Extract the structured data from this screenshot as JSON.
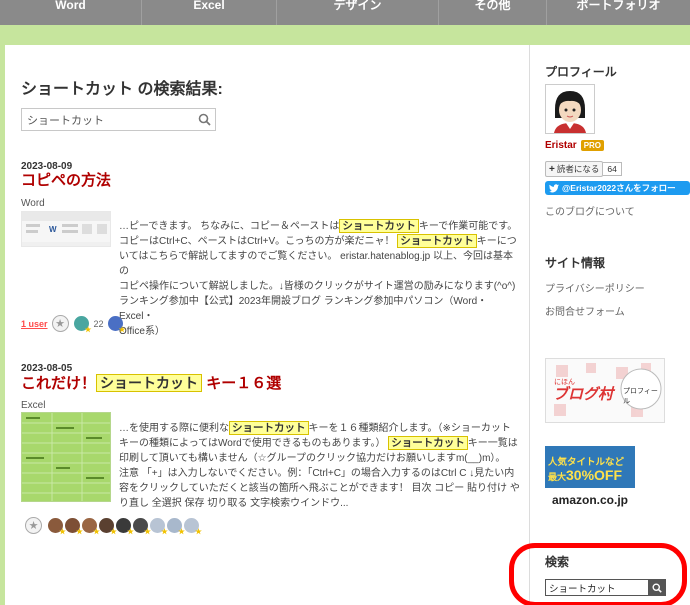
{
  "nav": [
    "Word",
    "Excel",
    "デザイン",
    "その他",
    "ポートフォリオ"
  ],
  "page_title": "ショートカット の検索結果:",
  "search_query": "ショートカット",
  "entries": [
    {
      "date": "2023-08-09",
      "title": "コピペの方法",
      "category": "Word",
      "excerpt": {
        "l1a": "…ピーできます。 ちなみに、コピー＆ペーストは",
        "hl": "ショートカット",
        "l1b": "キーで作業可能です。",
        "l2": "コピーはCtrl+C、ペーストはCtrl+V。こっちの方が楽だニャ！",
        "l2b": "キーにつ",
        "l3": "いてはこちらで解説してますのでご覧ください。 eristar.hatenablog.jp 以上、今回は基本の",
        "l4": "コピペ操作について解説しました。↓皆様のクリックがサイト運営の励みになります(^o^)",
        "l5": "ランキング参加中【公式】2023年開設ブログ ランキング参加中パソコン（Word・Excel・",
        "l6": "Office系）"
      },
      "users_label": "1 user",
      "star_count": "22"
    },
    {
      "date": "2023-08-05",
      "title_pre": "これだけ！",
      "title_hl": "ショートカット",
      "title_post": "キー１６選",
      "category": "Excel",
      "excerpt": {
        "l1a": "…を使用する際に便利な",
        "hl": "ショートカット",
        "l1b": "キーを１６種類紹介します。（※ショーカット",
        "l2": "キーの種類によってはWordで使用できるものもあります。）",
        "l2b": "キー一覧は",
        "l3": "印刷して頂いても構いません（☆グループのクリック協力だけお願いしますm(__)m）。",
        "l4": "注意 「+」は入力しないでください。例：「Ctrl+C」の場合入力するのはCtrl C ↓見たい内",
        "l5": "容をクリックしていただくと該当の箇所へ飛ぶことができます！ 目次 コピー 貼り付け や",
        "l6": "り直し 全選択 保存 切り取る 文字検索ウインドウ..."
      }
    }
  ],
  "sidebar": {
    "profile_heading": "プロフィール",
    "name": "Eristar",
    "pro_badge": "PRO",
    "reader_button": "読者になる",
    "reader_count": "64",
    "twitter_follow": "@Eristar2022さんをフォロー",
    "about_link": "このブログについて",
    "site_info_heading": "サイト情報",
    "privacy_link": "プライバシーポリシー",
    "contact_link": "お問合せフォーム",
    "blogmura_text": "ブログ村",
    "blogmura_sub": "にほん",
    "blogmura_profile": "プロフィール",
    "amazon_line1": "人気タイトルなど",
    "amazon_line2a": "最大",
    "amazon_line2b": "30%OFF",
    "amazon_logo": "amazon.co.jp",
    "search_heading": "検索",
    "search_value": "ショートカット"
  }
}
